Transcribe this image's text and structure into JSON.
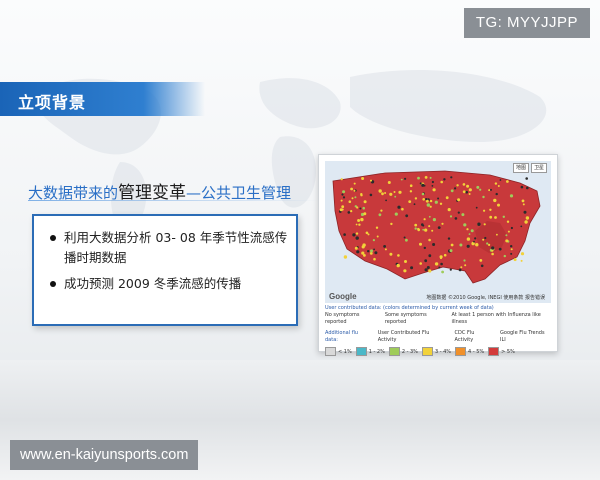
{
  "badge": {
    "text": "TG: MYYJJPP"
  },
  "slide": {
    "section_title": "立项背景",
    "subtitle": {
      "part1": "大数据带来的",
      "part2": "管理变革",
      "part3": "—公共卫生管理"
    },
    "bullets": [
      "利用大数据分析 03- 08 年季节性流感传播时期数据",
      "成功预测 2009 冬季流感的传播"
    ]
  },
  "map": {
    "toolbar": [
      "地图",
      "卫星"
    ],
    "google_label": "Google",
    "credits": "地图数据 ©2010 Google, INEGI  使用条款  报告错误",
    "user_data_title": "User contributed data: (colors determined by current week of data)",
    "user_data_items": [
      "No symptoms reported",
      "Some symptoms reported",
      "At least 1 person with Influenza like illness"
    ],
    "additional_label": "Additional flu data:",
    "additional_items": [
      "User Contributed Flu Activity",
      "CDC Flu Activity",
      "Google Flu Trends ILI"
    ],
    "legend": [
      {
        "label": "< 1%",
        "color": "#d9d9d9"
      },
      {
        "label": "1 - 2%",
        "color": "#4bb8c8"
      },
      {
        "label": "2 - 3%",
        "color": "#9fcc5a"
      },
      {
        "label": "3 - 4%",
        "color": "#f2d23a"
      },
      {
        "label": "4 - 5%",
        "color": "#f0902a"
      },
      {
        "label": "> 5%",
        "color": "#d33b3b"
      }
    ]
  },
  "watermark": {
    "text": "www.en-kaiyunsports.com"
  },
  "colors": {
    "accent_blue": "#2b6cb6",
    "map_red": "#d33b3b",
    "badge_gray": "#8a8f95"
  }
}
